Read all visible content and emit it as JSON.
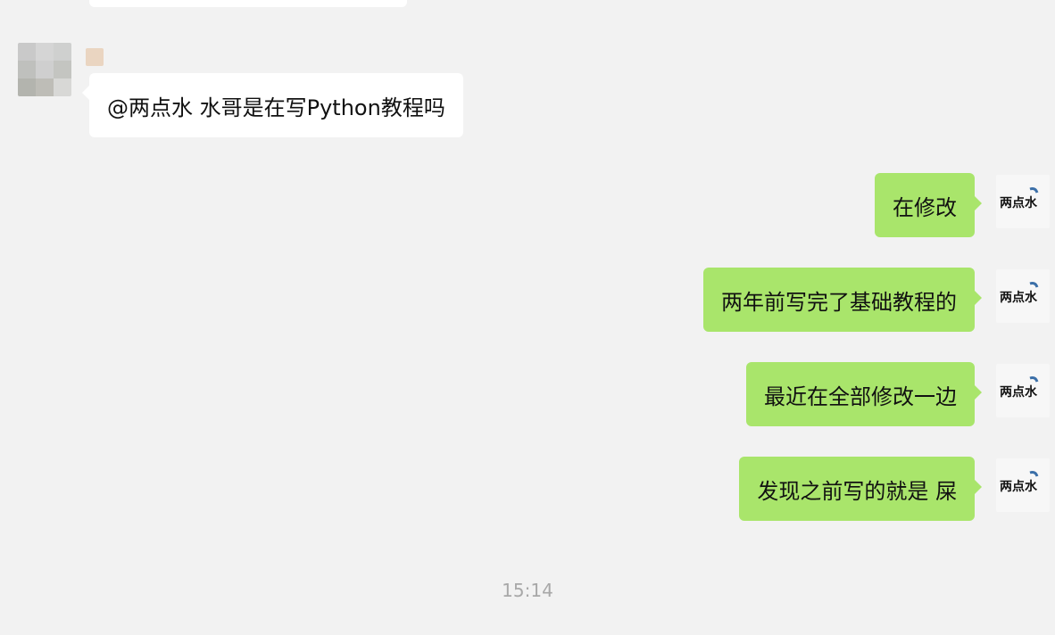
{
  "messages": {
    "incoming": [
      {
        "text": "@两点水 水哥是在写Python教程吗"
      }
    ],
    "outgoing": [
      {
        "text": "在修改"
      },
      {
        "text": "两年前写完了基础教程的"
      },
      {
        "text": "最近在全部修改一边"
      },
      {
        "text": "发现之前写的就是 屎"
      }
    ]
  },
  "timestamp": "15:14",
  "avatar_self": {
    "logo_text": "两点水"
  },
  "colors": {
    "background": "#f2f2f2",
    "incoming_bubble": "#ffffff",
    "outgoing_bubble": "#a9e56b",
    "timestamp_text": "#a8a8a8"
  }
}
